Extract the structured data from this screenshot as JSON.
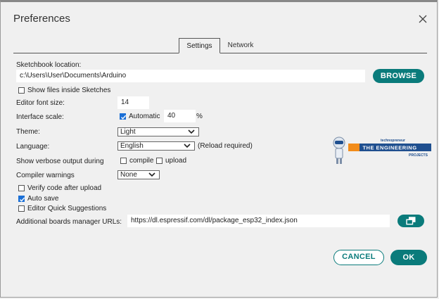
{
  "window": {
    "title": "Preferences"
  },
  "tabs": [
    {
      "label": "Settings",
      "active": true
    },
    {
      "label": "Network",
      "active": false
    }
  ],
  "sketchbook": {
    "label": "Sketchbook location:",
    "value": "c:\\Users\\User\\Documents\\Arduino",
    "browse_label": "BROWSE"
  },
  "show_files": {
    "label": "Show files inside Sketches",
    "checked": false
  },
  "font_size": {
    "label": "Editor font size:",
    "value": "14"
  },
  "interface_scale": {
    "label": "Interface scale:",
    "automatic_label": "Automatic",
    "automatic_checked": true,
    "value": "40",
    "unit": "%"
  },
  "theme": {
    "label": "Theme:",
    "value": "Light"
  },
  "language": {
    "label": "Language:",
    "value": "English",
    "note": "(Reload required)"
  },
  "verbose": {
    "label": "Show verbose output during",
    "compile_label": "compile",
    "upload_label": "upload",
    "compile_checked": false,
    "upload_checked": false
  },
  "compiler_warnings": {
    "label": "Compiler warnings",
    "value": "None"
  },
  "verify": {
    "label": "Verify code after upload",
    "checked": false
  },
  "autosave": {
    "label": "Auto save",
    "checked": true
  },
  "quick_suggestions": {
    "label": "Editor Quick Suggestions",
    "checked": false
  },
  "boards_urls": {
    "label": "Additional boards manager URLs:",
    "value": "https://dl.espressif.com/dl/package_esp32_index.json"
  },
  "buttons": {
    "cancel": "CANCEL",
    "ok": "OK"
  },
  "watermark": {
    "top": "technopreneur",
    "name": "THE ENGINEERING",
    "sub": "PROJECTS"
  },
  "colors": {
    "accent": "#0a7b7b",
    "checkbox": "#1a6fd6",
    "background": "#f0f0f0"
  }
}
